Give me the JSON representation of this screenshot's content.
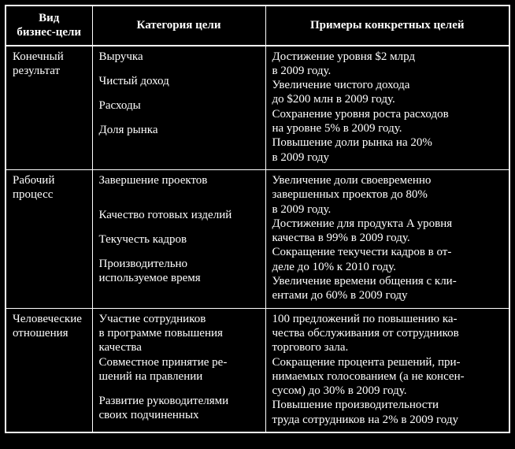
{
  "headers": {
    "col1_line1": "Вид",
    "col1_line2": "бизнес-цели",
    "col2": "Категория цели",
    "col3": "Примеры конкретных целей"
  },
  "chart_data": {
    "type": "table",
    "columns": [
      "Вид бизнес-цели",
      "Категория цели",
      "Примеры конкретных целей"
    ],
    "rows": [
      {
        "type": "Конечный результат",
        "categories": [
          "Выручка",
          "Чистый доход",
          "Расходы",
          "Доля рынка"
        ],
        "examples": [
          "Достижение уровня $2 млрд в 2009 году.",
          "Увеличение чистого дохода до $200 млн в 2009 году.",
          "Сохранение уровня роста расходов на уровне 5% в 2009 году.",
          "Повышение доли рынка на 20% в 2009 году"
        ]
      },
      {
        "type": "Рабочий процесс",
        "categories": [
          "Завершение проектов",
          "Качество готовых изделий",
          "Текучесть кадров",
          "Производительно используемое время"
        ],
        "examples": [
          "Увеличение доли своевременно завершенных проектов до 80% в 2009 году.",
          "Достижение для продукта A уровня качества в 99% в 2009 году.",
          "Сокращение текучести кадров в отделе до 10% к 2010 году.",
          "Увеличение времени общения с клиентами до 60% в 2009 году"
        ]
      },
      {
        "type": "Человеческие отношения",
        "categories": [
          "Участие сотрудников в программе повышения качества",
          "Совместное принятие решений на правлении",
          "Развитие руководителями своих подчиненных"
        ],
        "examples": [
          "100 предложений по повышению качества обслуживания от сотрудников торгового зала.",
          "Сокращение процента решений, принимаемых голосованием (а не консенсусом) до 30% в 2009 году.",
          "Повышение производительности труда сотрудников на 2% в 2009 году"
        ]
      }
    ]
  },
  "row1": {
    "type_l1": "Конечный",
    "type_l2": "результат",
    "cat_l1": "Выручка",
    "cat_l2": "Чистый доход",
    "cat_l3": "Расходы",
    "cat_l4": "Доля рынка",
    "ex_l1": "Достижение уровня $2 млрд",
    "ex_l2": "в 2009 году.",
    "ex_l3": "Увеличение чистого дохода",
    "ex_l4": "до $200 млн в 2009 году.",
    "ex_l5": "Сохранение уровня роста расходов",
    "ex_l6": "на уровне 5% в 2009 году.",
    "ex_l7": "Повышение доли рынка на 20%",
    "ex_l8": "в 2009 году"
  },
  "row2": {
    "type_l1": "Рабочий",
    "type_l2": "процесс",
    "cat_l1": "Завершение проектов",
    "cat_l2": "Качество готовых изделий",
    "cat_l3": "Текучесть кадров",
    "cat_l4": "Производительно",
    "cat_l5": "используемое время",
    "ex_l1": "Увеличение доли своевременно",
    "ex_l2": "завершенных проектов до 80%",
    "ex_l3": "в 2009 году.",
    "ex_l4": "Достижение для продукта A уровня",
    "ex_l5": "качества в 99% в 2009 году.",
    "ex_l6": "Сокращение текучести кадров в от-",
    "ex_l7": "деле до 10% к 2010 году.",
    "ex_l8": "Увеличение времени общения с кли-",
    "ex_l9": "ентами до 60% в 2009 году"
  },
  "row3": {
    "type_l1": "Человеческие",
    "type_l2": "отношения",
    "cat_l1": "Участие сотрудников",
    "cat_l2": "в программе повышения",
    "cat_l3": "качества",
    "cat_l4": "Совместное принятие ре-",
    "cat_l5": "шений на правлении",
    "cat_l6": "Развитие руководителями",
    "cat_l7": "своих подчиненных",
    "ex_l1": "100 предложений по повышению ка-",
    "ex_l2": "чества обслуживания от сотрудников",
    "ex_l3": "торгового зала.",
    "ex_l4": "Сокращение процента решений, при-",
    "ex_l5": "нимаемых голосованием (а не консен-",
    "ex_l6": "сусом) до 30% в 2009 году.",
    "ex_l7": "Повышение производительности",
    "ex_l8": "труда сотрудников на 2% в 2009 году"
  }
}
